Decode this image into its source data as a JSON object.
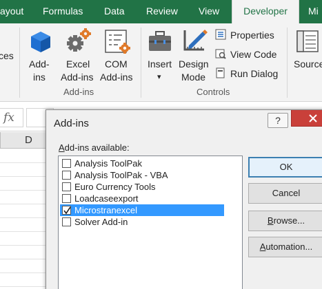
{
  "tabs": [
    "ayout",
    "Formulas",
    "Data",
    "Review",
    "View",
    "Developer",
    "Mi"
  ],
  "active_tab": "Developer",
  "ribbon": {
    "left_cut_label": "ces",
    "addins_btn": [
      "Add-",
      "ins"
    ],
    "excel_addins_btn": [
      "Excel",
      "Add-ins"
    ],
    "com_addins_btn": [
      "COM",
      "Add-ins"
    ],
    "addins_group": "Add-ins",
    "insert_btn": "Insert",
    "insert_arrow": "▾",
    "design_mode_btn": [
      "Design",
      "Mode"
    ],
    "properties": "Properties",
    "view_code": "View Code",
    "run_dialog": "Run Dialog",
    "controls_group": "Controls",
    "source_btn": "Source"
  },
  "formula_bar": {
    "fx": "fx"
  },
  "sheet": {
    "column": "D"
  },
  "dialog": {
    "title": "Add-ins",
    "help": "?",
    "available_label_prefix": "A",
    "available_label_rest": "dd-ins available:",
    "items": [
      {
        "label": "Analysis ToolPak",
        "checked": false,
        "selected": false
      },
      {
        "label": "Analysis ToolPak - VBA",
        "checked": false,
        "selected": false
      },
      {
        "label": "Euro Currency Tools",
        "checked": false,
        "selected": false
      },
      {
        "label": "Loadcaseexport",
        "checked": false,
        "selected": false
      },
      {
        "label": "Microstranexcel",
        "checked": true,
        "selected": true
      },
      {
        "label": "Solver Add-in",
        "checked": false,
        "selected": false
      }
    ],
    "ok": "OK",
    "cancel": "Cancel",
    "browse_u": "B",
    "browse_rest": "rowse...",
    "automation_u": "A",
    "automation_rest": "utomation..."
  },
  "colors": {
    "excel_green": "#217346",
    "selection": "#3399ff",
    "close_red": "#c9403a"
  }
}
